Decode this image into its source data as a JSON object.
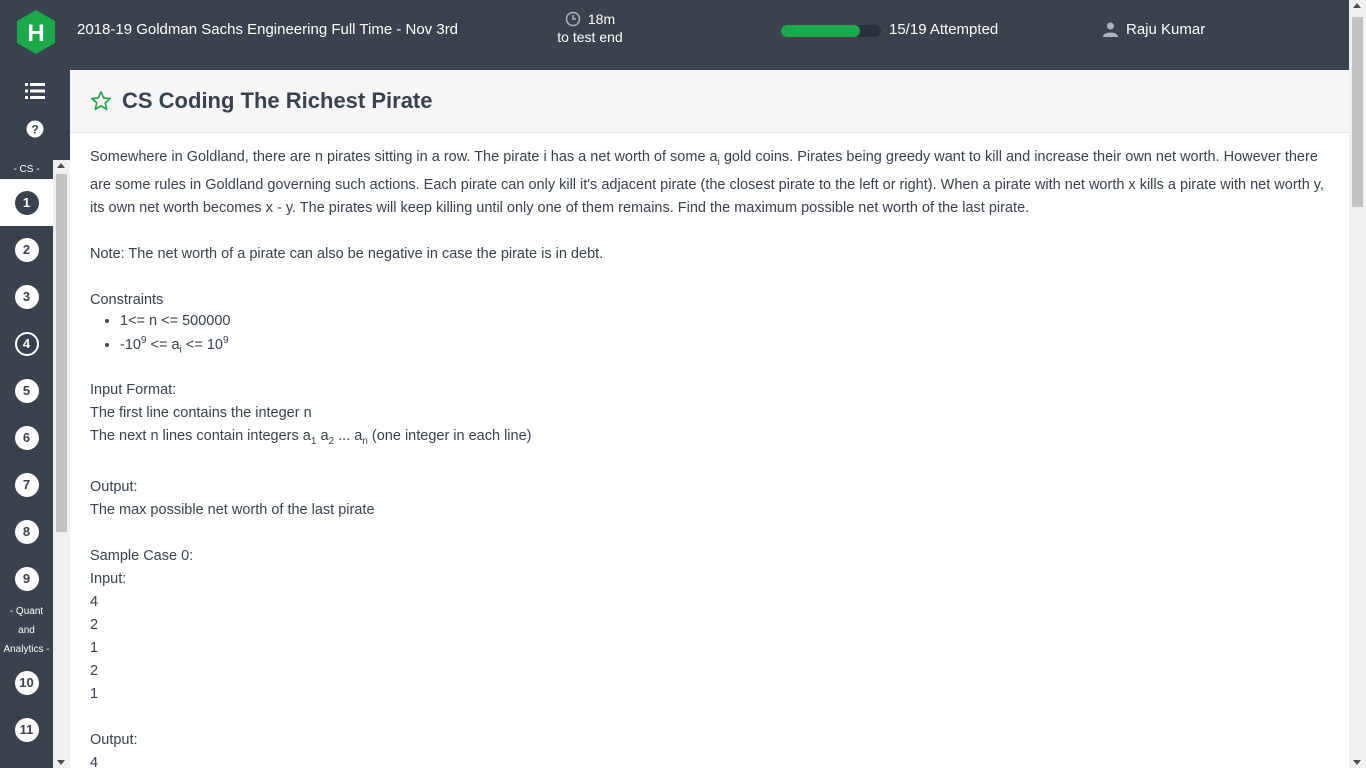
{
  "header": {
    "logo_letter": "H",
    "test_title": "2018-19 Goldman Sachs Engineering Full Time - Nov 3rd",
    "timer_value": "18m",
    "timer_label": "to test end",
    "progress_fraction": 0.789,
    "attempted_label": "15/19 Attempted",
    "user_name": "Raju Kumar"
  },
  "sidebar": {
    "sections": [
      {
        "label": "- CS -",
        "items": [
          "1",
          "2",
          "3",
          "4",
          "5",
          "6",
          "7",
          "8",
          "9"
        ]
      },
      {
        "label_lines": [
          "- Quant",
          "and",
          "Analytics -"
        ],
        "items": [
          "10",
          "11"
        ]
      }
    ],
    "active_question": "1",
    "outlined_question": "4"
  },
  "question": {
    "title": "CS Coding The Richest Pirate",
    "p1_a": "Somewhere in Goldland, there are n pirates sitting in a row. The pirate i has a net worth of some a",
    "p1_sub": "i",
    "p1_b": " gold coins. Pirates being greedy want to kill and increase their own net worth. However there are some rules in Goldland governing such actions. Each pirate can only kill it's adjacent pirate (the closest pirate to the left or right). When a pirate with net worth x kills a pirate with net worth y, its own net worth becomes x - y. The pirates will keep killing until only one of them remains. Find the maximum possible net worth of the last pirate.",
    "note": "Note: The net worth of a pirate can also be negative in case the pirate is in debt.",
    "constraints_label": "Constraints",
    "constraint1": "1<= n <= 500000",
    "c2_a": "-10",
    "c2_sup1": "9",
    "c2_b": " <= a",
    "c2_sub": "i",
    "c2_c": " <= 10",
    "c2_sup2": "9",
    "input_format_label": "Input Format:",
    "input_line1": "The first line contains the integer n",
    "il2_a": "The next n lines contain integers a",
    "il2_sub1": "1",
    "il2_b": " a",
    "il2_sub2": "2",
    "il2_c": " ... a",
    "il2_sub3": "n",
    "il2_d": " (one integer in each line)",
    "output_label": "Output:",
    "output_desc": "The max possible net worth of the last pirate",
    "sample_label": "Sample Case 0:",
    "sample_input_label": "Input:",
    "sample_input": [
      "4",
      "2",
      "1",
      "2",
      "1"
    ],
    "sample_output_label": "Output:",
    "sample_output": "4"
  },
  "colors": {
    "header_bg": "#39424e",
    "progress_fill": "#1ba94c",
    "logo_green": "#1ba94c"
  },
  "icons": [
    "hackerrank-logo-icon",
    "clock-icon",
    "user-icon",
    "list-icon",
    "help-icon",
    "star-outline-icon"
  ]
}
